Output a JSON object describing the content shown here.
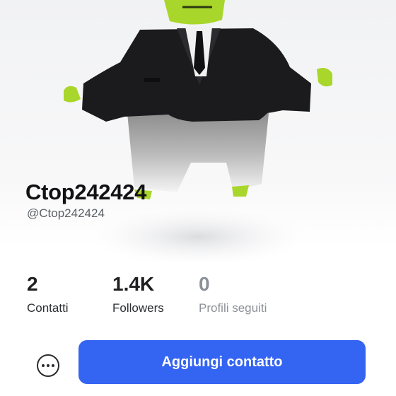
{
  "profile": {
    "display_name": "Ctop242424",
    "handle": "@Ctop242424"
  },
  "stats": [
    {
      "value": "2",
      "label": "Contatti"
    },
    {
      "value": "1.4K",
      "label": "Followers"
    },
    {
      "value": "0",
      "label": "Profili seguiti"
    }
  ],
  "actions": {
    "more_icon": "more-horizontal-icon",
    "add_contact_label": "Aggiungi contatto"
  },
  "colors": {
    "primary_button": "#3464f2",
    "avatar_head": "#a9d62b",
    "avatar_suit": "#1b1b1d"
  }
}
